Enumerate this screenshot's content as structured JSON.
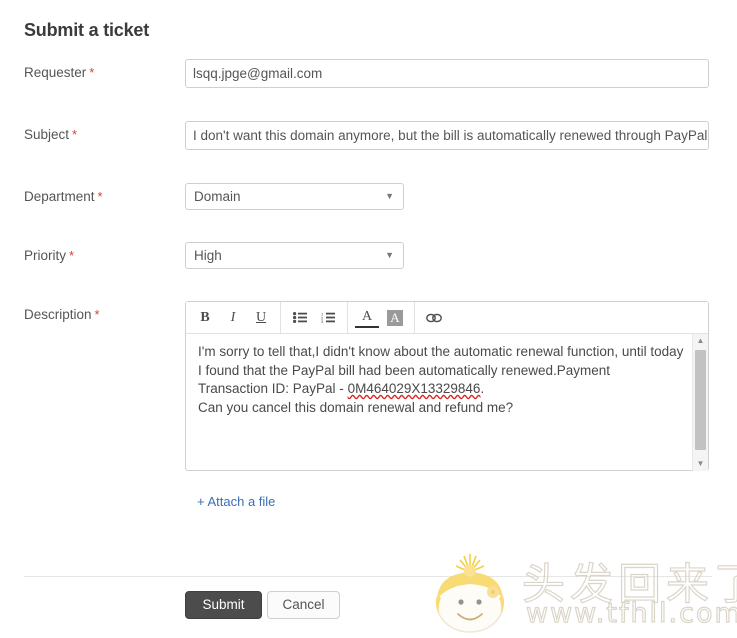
{
  "page": {
    "title": "Submit a ticket"
  },
  "fields": {
    "requester": {
      "label": "Requester",
      "required_mark": "*",
      "value": "lsqq.jpge@gmail.com"
    },
    "subject": {
      "label": "Subject",
      "required_mark": "*",
      "value": "I don't want this domain anymore, but the bill is automatically renewed through PayPal"
    },
    "department": {
      "label": "Department",
      "required_mark": "*",
      "value": "Domain",
      "arrow": "▼"
    },
    "priority": {
      "label": "Priority",
      "required_mark": "*",
      "value": "High",
      "arrow": "▼"
    },
    "description": {
      "label": "Description",
      "required_mark": "*",
      "lines": [
        "I'm sorry to tell that,I didn't know about the automatic renewal function, until today",
        "I found that the PayPal bill had been automatically renewed.Payment",
        "Transaction ID: PayPal - ",
        "Can you cancel this domain renewal and refund me?"
      ],
      "transaction_id": "0M464029X13329846",
      "transaction_id_suffix": "."
    }
  },
  "toolbar": {
    "bold": "B",
    "italic": "I",
    "underline": "U",
    "bullet_list": "☰",
    "numbered_list": "≡",
    "font_color": "A",
    "highlight": "A",
    "link": "∞"
  },
  "scrollbar": {
    "up_arrow": "▲",
    "down_arrow": "▼"
  },
  "actions": {
    "attach": "+ Attach a file",
    "submit": "Submit",
    "cancel": "Cancel"
  },
  "watermark": {
    "text_cn": "头发回来了",
    "text_url": "www.tfhll.com"
  }
}
